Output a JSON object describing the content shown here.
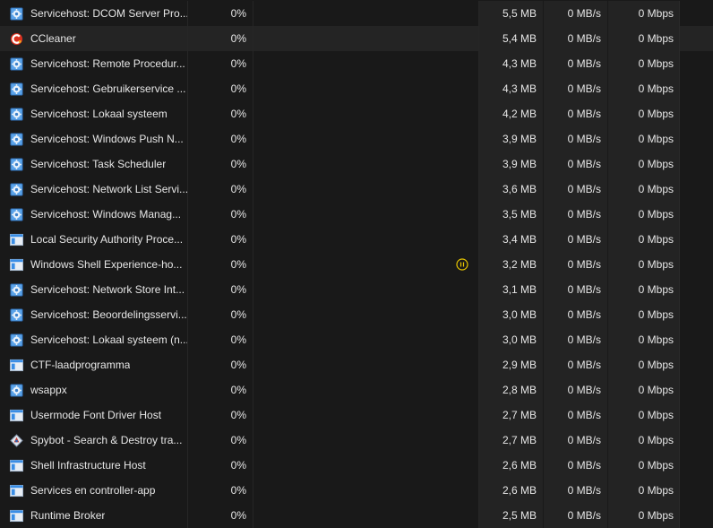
{
  "processes": [
    {
      "name": "Servicehost: DCOM Server Pro...",
      "cpu": "0%",
      "memory": "5,5 MB",
      "disk": "0 MB/s",
      "network": "0 Mbps",
      "icon": "service-gear-icon",
      "highlight": false,
      "paused": false
    },
    {
      "name": "CCleaner",
      "cpu": "0%",
      "memory": "5,4 MB",
      "disk": "0 MB/s",
      "network": "0 Mbps",
      "icon": "ccleaner-icon",
      "highlight": true,
      "paused": false
    },
    {
      "name": "Servicehost: Remote Procedur...",
      "cpu": "0%",
      "memory": "4,3 MB",
      "disk": "0 MB/s",
      "network": "0 Mbps",
      "icon": "service-gear-icon",
      "highlight": false,
      "paused": false
    },
    {
      "name": "Servicehost: Gebruikerservice ...",
      "cpu": "0%",
      "memory": "4,3 MB",
      "disk": "0 MB/s",
      "network": "0 Mbps",
      "icon": "service-gear-icon",
      "highlight": false,
      "paused": false
    },
    {
      "name": "Servicehost: Lokaal systeem",
      "cpu": "0%",
      "memory": "4,2 MB",
      "disk": "0 MB/s",
      "network": "0 Mbps",
      "icon": "service-gear-icon",
      "highlight": false,
      "paused": false
    },
    {
      "name": "Servicehost: Windows Push N...",
      "cpu": "0%",
      "memory": "3,9 MB",
      "disk": "0 MB/s",
      "network": "0 Mbps",
      "icon": "service-gear-icon",
      "highlight": false,
      "paused": false
    },
    {
      "name": "Servicehost: Task Scheduler",
      "cpu": "0%",
      "memory": "3,9 MB",
      "disk": "0 MB/s",
      "network": "0 Mbps",
      "icon": "service-gear-icon",
      "highlight": false,
      "paused": false
    },
    {
      "name": "Servicehost: Network List Servi...",
      "cpu": "0%",
      "memory": "3,6 MB",
      "disk": "0 MB/s",
      "network": "0 Mbps",
      "icon": "service-gear-icon",
      "highlight": false,
      "paused": false
    },
    {
      "name": "Servicehost: Windows Manag...",
      "cpu": "0%",
      "memory": "3,5 MB",
      "disk": "0 MB/s",
      "network": "0 Mbps",
      "icon": "service-gear-icon",
      "highlight": false,
      "paused": false
    },
    {
      "name": "Local Security Authority Proce...",
      "cpu": "0%",
      "memory": "3,4 MB",
      "disk": "0 MB/s",
      "network": "0 Mbps",
      "icon": "window-app-icon",
      "highlight": false,
      "paused": false
    },
    {
      "name": "Windows Shell Experience-ho...",
      "cpu": "0%",
      "memory": "3,2 MB",
      "disk": "0 MB/s",
      "network": "0 Mbps",
      "icon": "window-app-icon",
      "highlight": false,
      "paused": true
    },
    {
      "name": "Servicehost: Network Store Int...",
      "cpu": "0%",
      "memory": "3,1 MB",
      "disk": "0 MB/s",
      "network": "0 Mbps",
      "icon": "service-gear-icon",
      "highlight": false,
      "paused": false
    },
    {
      "name": "Servicehost: Beoordelingsservi...",
      "cpu": "0%",
      "memory": "3,0 MB",
      "disk": "0 MB/s",
      "network": "0 Mbps",
      "icon": "service-gear-icon",
      "highlight": false,
      "paused": false
    },
    {
      "name": "Servicehost: Lokaal systeem (n...",
      "cpu": "0%",
      "memory": "3,0 MB",
      "disk": "0 MB/s",
      "network": "0 Mbps",
      "icon": "service-gear-icon",
      "highlight": false,
      "paused": false
    },
    {
      "name": "CTF-laadprogramma",
      "cpu": "0%",
      "memory": "2,9 MB",
      "disk": "0 MB/s",
      "network": "0 Mbps",
      "icon": "window-app-icon",
      "highlight": false,
      "paused": false
    },
    {
      "name": "wsappx",
      "cpu": "0%",
      "memory": "2,8 MB",
      "disk": "0 MB/s",
      "network": "0 Mbps",
      "icon": "service-gear-icon",
      "highlight": false,
      "paused": false
    },
    {
      "name": "Usermode Font Driver Host",
      "cpu": "0%",
      "memory": "2,7 MB",
      "disk": "0 MB/s",
      "network": "0 Mbps",
      "icon": "window-app-icon",
      "highlight": false,
      "paused": false
    },
    {
      "name": "Spybot - Search & Destroy tra...",
      "cpu": "0%",
      "memory": "2,7 MB",
      "disk": "0 MB/s",
      "network": "0 Mbps",
      "icon": "spybot-icon",
      "highlight": false,
      "paused": false
    },
    {
      "name": "Shell Infrastructure Host",
      "cpu": "0%",
      "memory": "2,6 MB",
      "disk": "0 MB/s",
      "network": "0 Mbps",
      "icon": "window-app-icon",
      "highlight": false,
      "paused": false
    },
    {
      "name": "Services en controller-app",
      "cpu": "0%",
      "memory": "2,6 MB",
      "disk": "0 MB/s",
      "network": "0 Mbps",
      "icon": "window-app-icon",
      "highlight": false,
      "paused": false
    },
    {
      "name": "Runtime Broker",
      "cpu": "0%",
      "memory": "2,5 MB",
      "disk": "0 MB/s",
      "network": "0 Mbps",
      "icon": "window-app-icon",
      "highlight": false,
      "paused": false
    }
  ],
  "colors": {
    "paused_indicator": "#e8c600",
    "icon_blue": "#3a8ee6",
    "ccleaner_red": "#d9301e"
  }
}
